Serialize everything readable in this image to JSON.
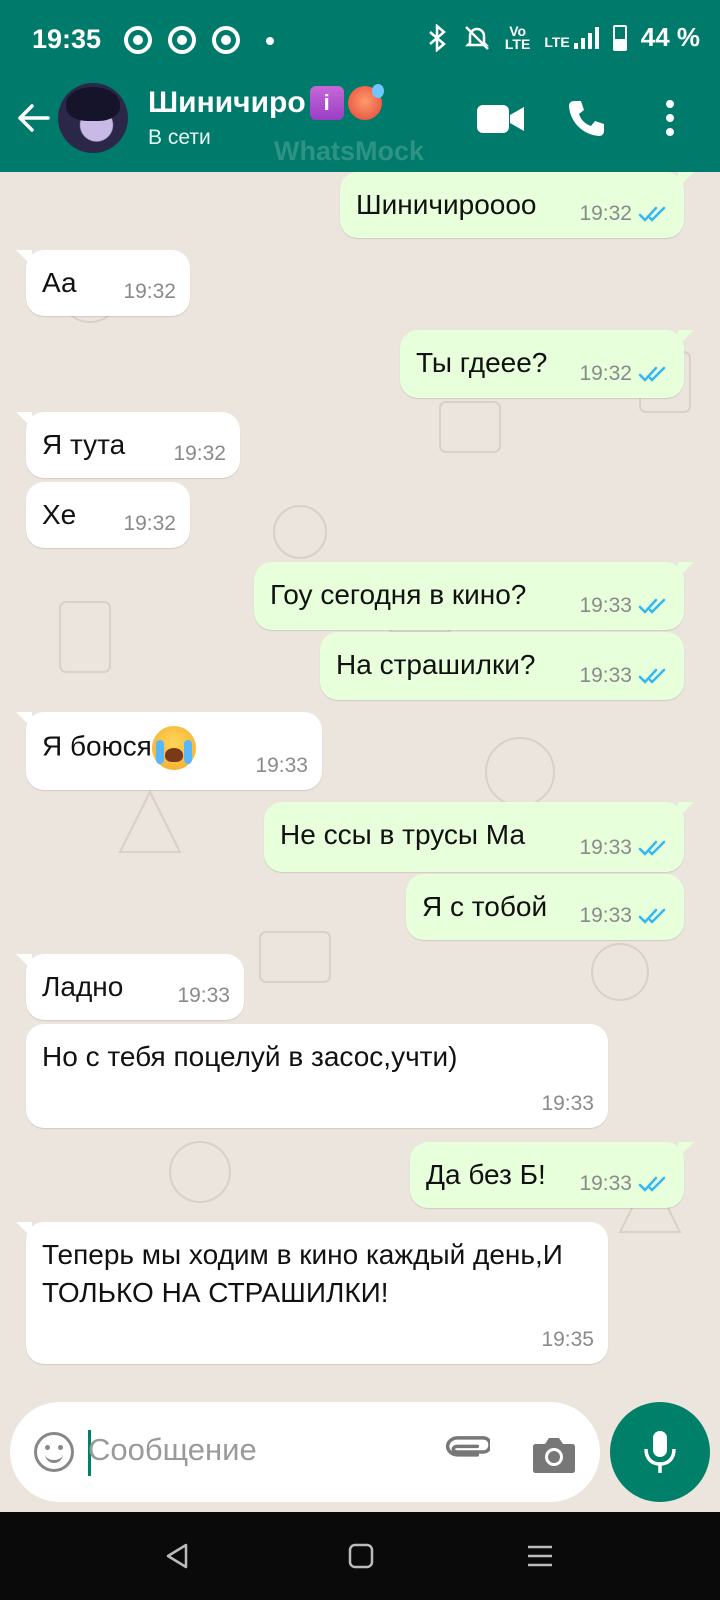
{
  "status_bar": {
    "time": "19:35",
    "network_small": "Vo\nLTE",
    "lte": "LTE",
    "battery_percent": "44 %"
  },
  "header": {
    "contact_name": "Шиничиро",
    "status": "В сети",
    "watermark": "WhatsMock"
  },
  "messages": [
    {
      "dir": "out",
      "text": "Шиничироооо",
      "time": "19:32"
    },
    {
      "dir": "in",
      "text": "Аа",
      "time": "19:32"
    },
    {
      "dir": "out",
      "text": "Ты гдеее?",
      "time": "19:32"
    },
    {
      "dir": "in",
      "text": "Я тута",
      "time": "19:32"
    },
    {
      "dir": "in",
      "text": "Хе",
      "time": "19:32"
    },
    {
      "dir": "out",
      "text": "Гоу сегодня в кино?",
      "time": "19:33"
    },
    {
      "dir": "out",
      "text": "На страшилки?",
      "time": "19:33"
    },
    {
      "dir": "in",
      "text": "Я боюся",
      "time": "19:33"
    },
    {
      "dir": "out",
      "text": "Не ссы в трусы Ма",
      "time": "19:33"
    },
    {
      "dir": "out",
      "text": "Я с тобой",
      "time": "19:33"
    },
    {
      "dir": "in",
      "text": "Ладно",
      "time": "19:33"
    },
    {
      "dir": "in",
      "text": "Но с тебя поцелуй в засос,учти)",
      "time": "19:33"
    },
    {
      "dir": "out",
      "text": "Да без Б!",
      "time": "19:33"
    },
    {
      "dir": "in",
      "text": "Теперь мы ходим в кино каждый день,И ТОЛЬКО НА СТРАШИЛКИ!",
      "time": "19:35"
    }
  ],
  "input": {
    "placeholder": "Сообщение"
  },
  "colors": {
    "teal": "#007a6b",
    "outgoing": "#e7ffdb",
    "incoming": "#ffffff",
    "read_ticks": "#34b7f1"
  }
}
